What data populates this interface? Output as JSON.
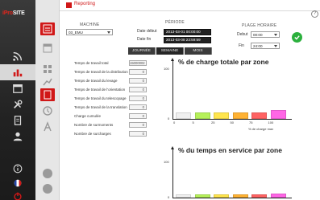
{
  "app": {
    "brand_prefix": "iPro",
    "brand_suffix": "SITE",
    "page_title": "Reporting"
  },
  "colors": {
    "accent": "#d01818",
    "ok": "#2bb03d",
    "bar_colors": [
      "#f0f0f0",
      "#b6f15a",
      "#ffe54d",
      "#ffb233",
      "#ff6363",
      "#ff66e6"
    ]
  },
  "machine": {
    "label": "MACHINE",
    "value": "03_EMU"
  },
  "periode": {
    "label": "PÉRIODE",
    "start_label": "Date début",
    "start_value": "2013-03-01 00:00:00",
    "end_label": "Date fin",
    "end_value": "2013-03-08 23:59:59",
    "tabs": [
      "JOURNÉE",
      "SEMAINE",
      "MOIS"
    ],
    "active_tab": "SEMAINE"
  },
  "plage": {
    "label": "PLAGE HORAIRE",
    "debut_label": "Debut",
    "debut_value": "00:00",
    "fin_label": "Fin",
    "fin_value": "24:00"
  },
  "stats": [
    {
      "label": "Temps de travail total",
      "value": "15000002"
    },
    {
      "label": "Temps de travail de la distribution",
      "value": "0"
    },
    {
      "label": "Temps de travail du levage",
      "value": "0"
    },
    {
      "label": "Temps de travail de l'orientation",
      "value": "0"
    },
    {
      "label": "Temps de travail du telescopage",
      "value": "0"
    },
    {
      "label": "Temps de travail de la translation",
      "value": "0"
    },
    {
      "label": "Charge cumulée",
      "value": "0"
    },
    {
      "label": "Nombre de surmoments",
      "value": "0"
    },
    {
      "label": "Nombre de surcharges",
      "value": "0"
    }
  ],
  "chart_data": [
    {
      "type": "bar",
      "title": "% de charge totale par zone",
      "xlabel": "% de charge max",
      "ylabel": "",
      "ylim": [
        0,
        100
      ],
      "y_ticks": [
        "100",
        "0"
      ],
      "categories": [
        "0",
        "5",
        "25",
        "50",
        "75",
        "100"
      ],
      "values": [
        12,
        13,
        13,
        13,
        13,
        17
      ]
    },
    {
      "type": "bar",
      "title": "% du temps en service par zone",
      "xlabel": "",
      "ylabel": "",
      "ylim": [
        0,
        100
      ],
      "y_ticks": [
        "100",
        "0"
      ],
      "categories": [
        "",
        "",
        "",
        "",
        "",
        ""
      ],
      "values": [
        8,
        9,
        9,
        9,
        9,
        11
      ]
    }
  ],
  "icons": {
    "sidebar": [
      "rss-icon",
      "chart-icon",
      "calendar-icon",
      "tools-icon",
      "document-icon",
      "users-icon",
      "info-icon",
      "flag-icon",
      "power-icon"
    ]
  }
}
